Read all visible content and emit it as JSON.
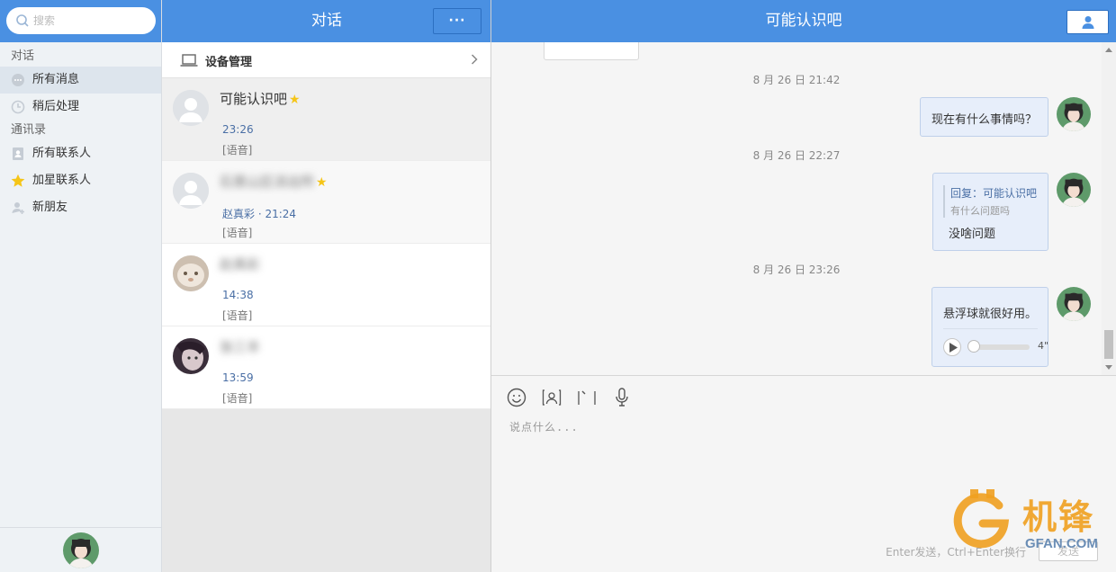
{
  "search": {
    "placeholder": "搜索"
  },
  "sidebar": {
    "section_conversations": "对话",
    "items_conv": [
      {
        "label": "所有消息",
        "icon": "chat-bubble-icon"
      },
      {
        "label": "稍后处理",
        "icon": "clock-icon"
      }
    ],
    "section_contacts": "通讯录",
    "items_contacts": [
      {
        "label": "所有联系人",
        "icon": "contact-book-icon"
      },
      {
        "label": "加星联系人",
        "icon": "star-icon"
      },
      {
        "label": "新朋友",
        "icon": "add-person-icon"
      }
    ]
  },
  "convlist": {
    "title": "对话",
    "more_label": "···",
    "device_label": "设备管理",
    "items": [
      {
        "name": "可能认识吧",
        "starred": true,
        "time": "23:26",
        "message": "[语音]"
      },
      {
        "name": "石景山区派出所",
        "starred": true,
        "sender": "赵真彩",
        "time": "21:24",
        "sub": "赵真彩 · 21:24",
        "message": "[语音]"
      },
      {
        "name": "赵真彩",
        "starred": false,
        "time": "14:38",
        "message": "[语音]"
      },
      {
        "name": "张三丰",
        "starred": false,
        "time": "13:59",
        "message": "[语音]"
      }
    ]
  },
  "chat": {
    "title": "可能认识吧",
    "messages": [
      {
        "timestamp": "8 月 26 日 21:42",
        "text": "现在有什么事情吗？"
      },
      {
        "timestamp": "8 月 26 日 22:27",
        "quote_title": "回复：可能认识吧",
        "quote_body": "有什么问题吗",
        "text": "没啥问题"
      },
      {
        "timestamp": "8 月 26 日 23:26",
        "text": "悬浮球就很好用。",
        "voice_duration": "4\"",
        "voice_progress": 0
      }
    ]
  },
  "composer": {
    "placeholder": "说点什么...",
    "hint": "Enter发送，Ctrl+Enter换行",
    "send_label": "发送"
  },
  "watermark": {
    "text": "机锋",
    "sub": "GFAN.COM"
  },
  "colors": {
    "accent": "#4a90e2",
    "bubble": "#e7eefa",
    "star": "#f5c518"
  }
}
